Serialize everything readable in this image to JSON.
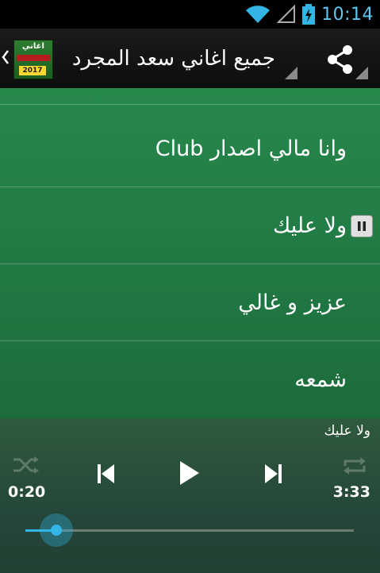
{
  "status_bar": {
    "time": "10:14",
    "icons": [
      "wifi-icon",
      "no-signal-icon",
      "battery-charging-icon"
    ]
  },
  "action_bar": {
    "app_icon_label": "اغاني",
    "app_icon_year": "2017",
    "title": "جميع اغاني سعد المجرد ب",
    "share_icon": "share-icon"
  },
  "list": {
    "items": [
      {
        "label": "وانا مالي اصدار Club",
        "playing": false
      },
      {
        "label": "ولا عليك",
        "playing": true
      },
      {
        "label": "عزيز و غالي",
        "playing": false
      },
      {
        "label": "شمعه",
        "playing": false
      }
    ]
  },
  "player": {
    "now_playing": "ولا عليك",
    "elapsed": "0:20",
    "duration": "3:33",
    "progress": 0.094,
    "controls": [
      "shuffle-icon",
      "previous-icon",
      "play-icon",
      "next-icon",
      "repeat-icon"
    ]
  },
  "colors": {
    "accent": "#33b5e5",
    "list_green": "#217a44",
    "player_bg": "#2a4f3a"
  }
}
